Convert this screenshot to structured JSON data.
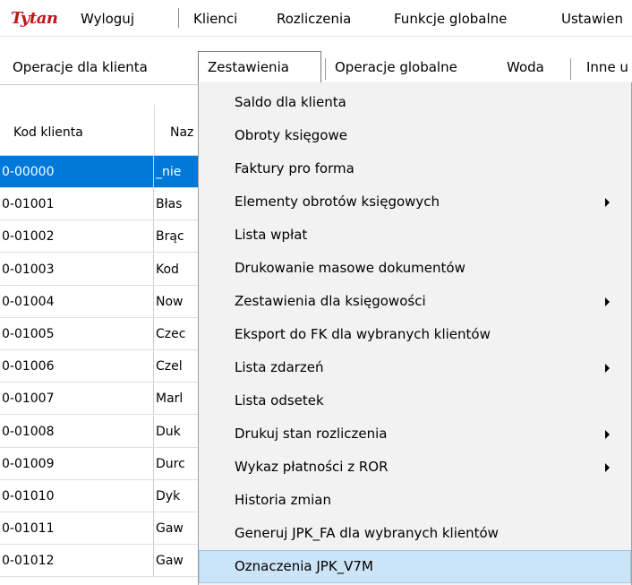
{
  "app": {
    "logo": "Tytan"
  },
  "menubar": {
    "items": [
      "Wyloguj",
      "Klienci",
      "Rozliczenia",
      "Funkcje globalne",
      "Ustawien"
    ]
  },
  "subbar": {
    "items": [
      "Operacje dla klienta",
      "Zestawienia",
      "Operacje globalne",
      "Woda",
      "Inne u"
    ]
  },
  "table": {
    "headers": [
      "Kod klienta",
      "Naz"
    ],
    "rows": [
      {
        "code": "0-00000",
        "name": "_nie",
        "selected": true
      },
      {
        "code": "0-01001",
        "name": "Błas"
      },
      {
        "code": "0-01002",
        "name": "Brąc"
      },
      {
        "code": "0-01003",
        "name": "Kod"
      },
      {
        "code": "0-01004",
        "name": "Now"
      },
      {
        "code": "0-01005",
        "name": "Czec"
      },
      {
        "code": "0-01006",
        "name": "Czel"
      },
      {
        "code": "0-01007",
        "name": "Marl"
      },
      {
        "code": "0-01008",
        "name": "Duk"
      },
      {
        "code": "0-01009",
        "name": "Durc"
      },
      {
        "code": "0-01010",
        "name": "Dyk"
      },
      {
        "code": "0-01011",
        "name": "Gaw"
      },
      {
        "code": "0-01012",
        "name": "Gaw"
      }
    ]
  },
  "dropdown": {
    "items": [
      {
        "label": "Saldo dla klienta",
        "submenu": false
      },
      {
        "label": "Obroty księgowe",
        "submenu": false
      },
      {
        "label": "Faktury pro forma",
        "submenu": false
      },
      {
        "label": "Elementy obrotów księgowych",
        "submenu": true
      },
      {
        "label": "Lista wpłat",
        "submenu": false
      },
      {
        "label": "Drukowanie masowe dokumentów",
        "submenu": false
      },
      {
        "label": "Zestawienia dla księgowości",
        "submenu": true
      },
      {
        "label": "Eksport do FK dla wybranych klientów",
        "submenu": false
      },
      {
        "label": "Lista zdarzeń",
        "submenu": true
      },
      {
        "label": "Lista odsetek",
        "submenu": false
      },
      {
        "label": "Drukuj stan rozliczenia",
        "submenu": true
      },
      {
        "label": "Wykaz płatności z ROR",
        "submenu": true
      },
      {
        "label": "Historia zmian",
        "submenu": false
      },
      {
        "label": "Generuj JPK_FA dla wybranych klientów",
        "submenu": false
      },
      {
        "label": "Oznaczenia JPK_V7M",
        "submenu": false,
        "highlighted": true
      }
    ]
  },
  "colors": {
    "logo": "#c0171b",
    "selection": "#0078d7",
    "menu_highlight": "#cce4f7"
  }
}
